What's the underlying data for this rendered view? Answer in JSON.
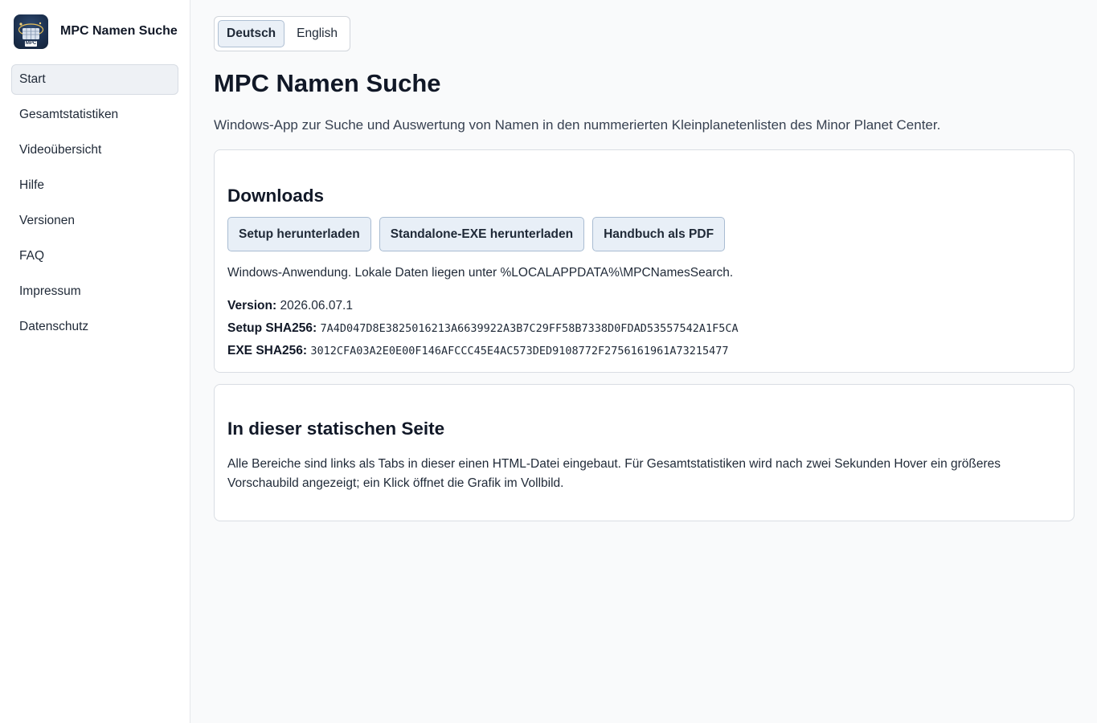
{
  "sidebar": {
    "brand_title": "MPC Namen Suche",
    "logo_text": "MPC",
    "items": [
      {
        "label": "Start",
        "active": true
      },
      {
        "label": "Gesamtstatistiken"
      },
      {
        "label": "Videoübersicht"
      },
      {
        "label": "Hilfe"
      },
      {
        "label": "Versionen"
      },
      {
        "label": "FAQ"
      },
      {
        "label": "Impressum"
      },
      {
        "label": "Datenschutz"
      }
    ]
  },
  "language": {
    "options": [
      "Deutsch",
      "English"
    ],
    "selected": "Deutsch"
  },
  "main": {
    "title": "MPC Namen Suche",
    "subtitle": "Windows-App zur Suche und Auswertung von Namen in den nummerierten Kleinplanetenlisten des Minor Planet Center."
  },
  "downloads": {
    "heading": "Downloads",
    "buttons": [
      "Setup herunterladen",
      "Standalone-EXE herunterladen",
      "Handbuch als PDF"
    ],
    "note": "Windows-Anwendung. Lokale Daten liegen unter %LOCALAPPDATA%\\MPCNamesSearch.",
    "version_label": "Version:",
    "version_value": "2026.06.07.1",
    "setup_sha_label": "Setup SHA256:",
    "setup_sha_value": "7A4D047D8E3825016213A6639922A3B7C29FF58B7338D0FDAD53557542A1F5CA",
    "exe_sha_label": "EXE SHA256:",
    "exe_sha_value": "3012CFA03A2E0E00F146AFCCC45E4AC573DED9108772F2756161961A73215477"
  },
  "about": {
    "heading": "In dieser statischen Seite",
    "text": "Alle Bereiche sind links als Tabs in dieser einen HTML-Datei eingebaut. Für Gesamtstatistiken wird nach zwei Sekunden Hover ein größeres Vorschaubild angezeigt; ein Klick öffnet die Grafik im Vollbild."
  }
}
